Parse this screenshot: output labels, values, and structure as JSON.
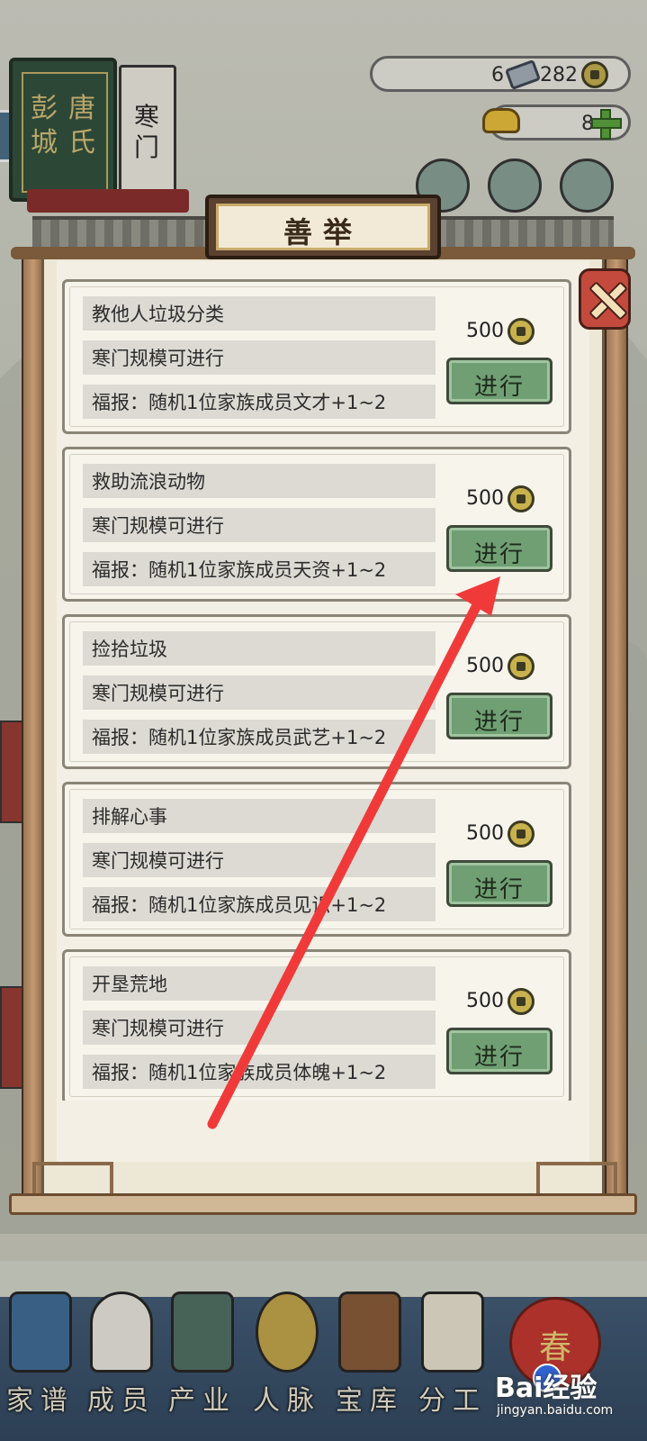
{
  "header": {
    "clan_surname": "唐氏",
    "clan_city": "彭城",
    "clan_scale": "寒门"
  },
  "resources": {
    "silver_count": "6",
    "coin_count": "282",
    "gold_count": "8"
  },
  "dialog": {
    "title": "善举",
    "items": [
      {
        "name": "教他人垃圾分类",
        "requirement": "寒门规模可进行",
        "reward": "福报：随机1位家族成员文才+1~2",
        "cost": "500",
        "action_label": "进行"
      },
      {
        "name": "救助流浪动物",
        "requirement": "寒门规模可进行",
        "reward": "福报：随机1位家族成员天资+1~2",
        "cost": "500",
        "action_label": "进行"
      },
      {
        "name": "捡拾垃圾",
        "requirement": "寒门规模可进行",
        "reward": "福报：随机1位家族成员武艺+1~2",
        "cost": "500",
        "action_label": "进行"
      },
      {
        "name": "排解心事",
        "requirement": "寒门规模可进行",
        "reward": "福报：随机1位家族成员见识+1~2",
        "cost": "500",
        "action_label": "进行"
      },
      {
        "name": "开垦荒地",
        "requirement": "寒门规模可进行",
        "reward": "福报：随机1位家族成员体魄+1~2",
        "cost": "500",
        "action_label": "进行"
      }
    ]
  },
  "bottom_nav": [
    {
      "label": "家谱",
      "icon": "genealogy-book-icon"
    },
    {
      "label": "成员",
      "icon": "member-portrait-icon"
    },
    {
      "label": "产业",
      "icon": "building-icon"
    },
    {
      "label": "人脉",
      "icon": "network-icon"
    },
    {
      "label": "宝库",
      "icon": "treasure-chest-icon"
    },
    {
      "label": "分工",
      "icon": "scroll-icon"
    }
  ],
  "spring_badge": "春",
  "watermark": {
    "brand": "Bai经验",
    "site": "jingyan.baidu.com"
  },
  "colors": {
    "button_green": "#6f9f73",
    "row_gray": "#dcdad2",
    "close_red": "#c44a3e",
    "annotation_arrow": "#f03a3a"
  }
}
